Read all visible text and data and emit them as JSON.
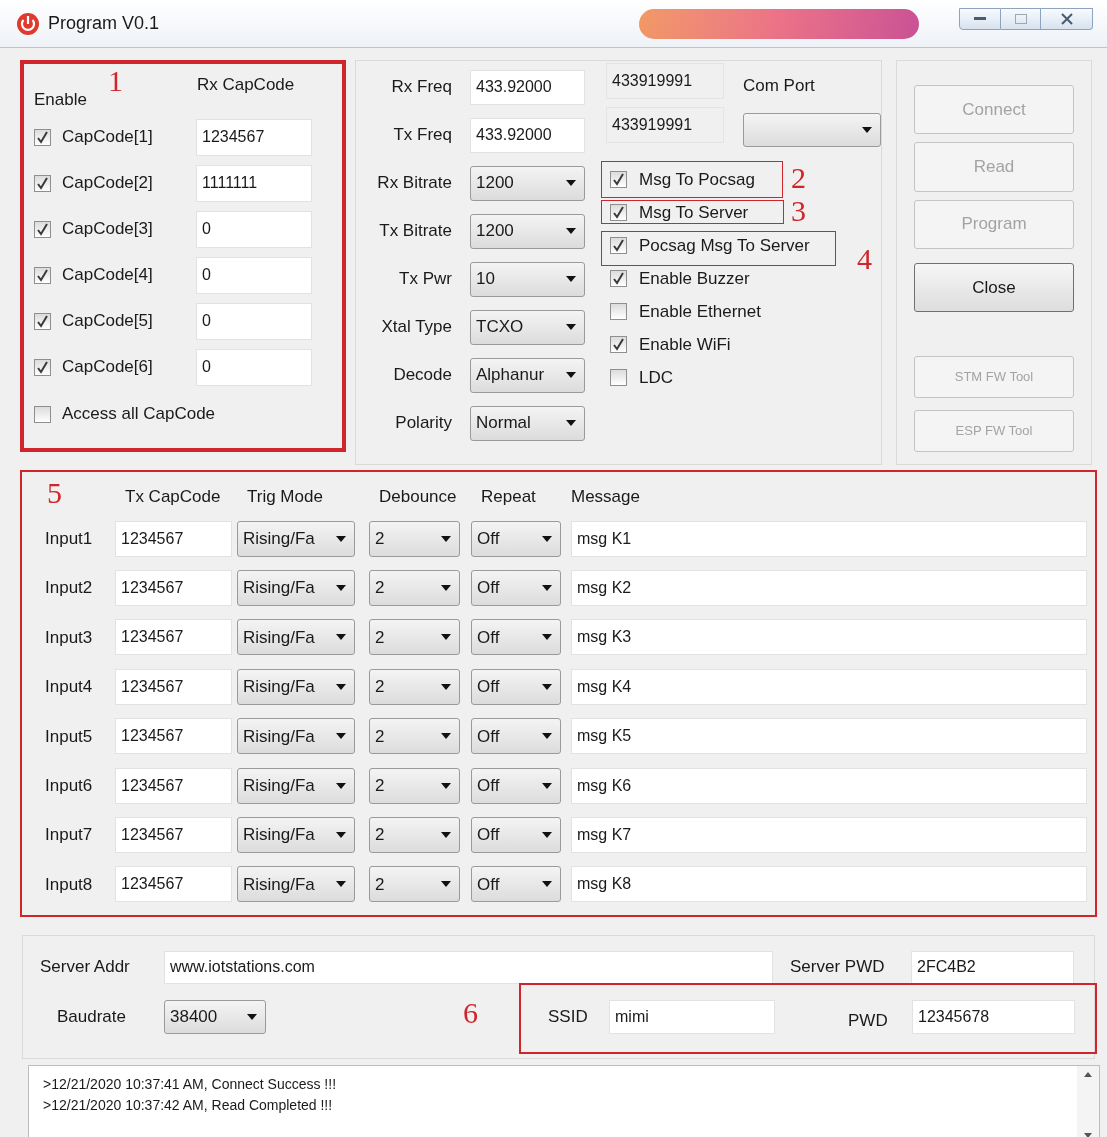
{
  "window": {
    "title": "Program V0.1"
  },
  "capcodes": {
    "enable_label": "Enable",
    "code_label": "Rx CapCode",
    "rows": [
      {
        "label": "CapCode[1]",
        "checked": true,
        "value": "1234567"
      },
      {
        "label": "CapCode[2]",
        "checked": true,
        "value": "1111111"
      },
      {
        "label": "CapCode[3]",
        "checked": true,
        "value": "0"
      },
      {
        "label": "CapCode[4]",
        "checked": true,
        "value": "0"
      },
      {
        "label": "CapCode[5]",
        "checked": true,
        "value": "0"
      },
      {
        "label": "CapCode[6]",
        "checked": true,
        "value": "0"
      }
    ],
    "access_all": {
      "label": "Access all CapCode",
      "checked": false
    }
  },
  "radio": {
    "fields": [
      {
        "kind": "input",
        "label": "Rx Freq",
        "value": "433.92000",
        "readout": "433919991"
      },
      {
        "kind": "input",
        "label": "Tx Freq",
        "value": "433.92000",
        "readout": "433919991"
      },
      {
        "kind": "select",
        "label": "Rx Bitrate",
        "value": "1200"
      },
      {
        "kind": "select",
        "label": "Tx Bitrate",
        "value": "1200"
      },
      {
        "kind": "select",
        "label": "Tx Pwr",
        "value": "10"
      },
      {
        "kind": "select",
        "label": "Xtal Type",
        "value": "TCXO"
      },
      {
        "kind": "select",
        "label": "Decode",
        "value": "Alphanur"
      },
      {
        "kind": "select",
        "label": "Polarity",
        "value": "Normal"
      }
    ],
    "com_port_label": "Com Port"
  },
  "options": [
    {
      "label": "Msg To Pocsag",
      "checked": true
    },
    {
      "label": "Msg To Server",
      "checked": true
    },
    {
      "label": "Pocsag Msg To Server",
      "checked": true
    },
    {
      "label": "Enable Buzzer",
      "checked": true
    },
    {
      "label": "Enable Ethernet",
      "checked": false
    },
    {
      "label": "Enable WiFi",
      "checked": true
    },
    {
      "label": "LDC",
      "checked": false
    }
  ],
  "buttons": [
    {
      "label": "Connect",
      "disabled": true
    },
    {
      "label": "Read",
      "disabled": true
    },
    {
      "label": "Program",
      "disabled": true
    },
    {
      "label": "Close",
      "disabled": false
    }
  ],
  "tools": [
    {
      "label": "STM FW Tool",
      "disabled": true
    },
    {
      "label": "ESP FW Tool",
      "disabled": true
    }
  ],
  "inputs": {
    "columns": [
      "Tx CapCode",
      "Trig Mode",
      "Debounce",
      "Repeat",
      "Message"
    ],
    "rows": [
      {
        "label": "Input1",
        "capcode": "1234567",
        "trig_mode": "Rising/Fa",
        "debounce": "2",
        "repeat": "Off",
        "message": "msg K1"
      },
      {
        "label": "Input2",
        "capcode": "1234567",
        "trig_mode": "Rising/Fa",
        "debounce": "2",
        "repeat": "Off",
        "message": "msg K2"
      },
      {
        "label": "Input3",
        "capcode": "1234567",
        "trig_mode": "Rising/Fa",
        "debounce": "2",
        "repeat": "Off",
        "message": "msg K3"
      },
      {
        "label": "Input4",
        "capcode": "1234567",
        "trig_mode": "Rising/Fa",
        "debounce": "2",
        "repeat": "Off",
        "message": "msg K4"
      },
      {
        "label": "Input5",
        "capcode": "1234567",
        "trig_mode": "Rising/Fa",
        "debounce": "2",
        "repeat": "Off",
        "message": "msg K5"
      },
      {
        "label": "Input6",
        "capcode": "1234567",
        "trig_mode": "Rising/Fa",
        "debounce": "2",
        "repeat": "Off",
        "message": "msg K6"
      },
      {
        "label": "Input7",
        "capcode": "1234567",
        "trig_mode": "Rising/Fa",
        "debounce": "2",
        "repeat": "Off",
        "message": "msg K7"
      },
      {
        "label": "Input8",
        "capcode": "1234567",
        "trig_mode": "Rising/Fa",
        "debounce": "2",
        "repeat": "Off",
        "message": "msg K8"
      }
    ]
  },
  "server": {
    "addr_label": "Server Addr",
    "addr": "www.iotstations.com",
    "pwd_label": "Server PWD",
    "pwd": "2FC4B2",
    "baud_label": "Baudrate",
    "baud": "38400",
    "ssid_label": "SSID",
    "ssid": "mimi",
    "wifi_pwd_label": "PWD",
    "wifi_pwd": "12345678"
  },
  "log": [
    ">12/21/2020 10:37:41 AM, Connect Success !!!",
    ">12/21/2020 10:37:42 AM, Read Completed !!!"
  ],
  "annotations": [
    {
      "label": "1"
    },
    {
      "label": "2"
    },
    {
      "label": "3"
    },
    {
      "label": "4"
    },
    {
      "label": "5"
    },
    {
      "label": "6"
    }
  ]
}
